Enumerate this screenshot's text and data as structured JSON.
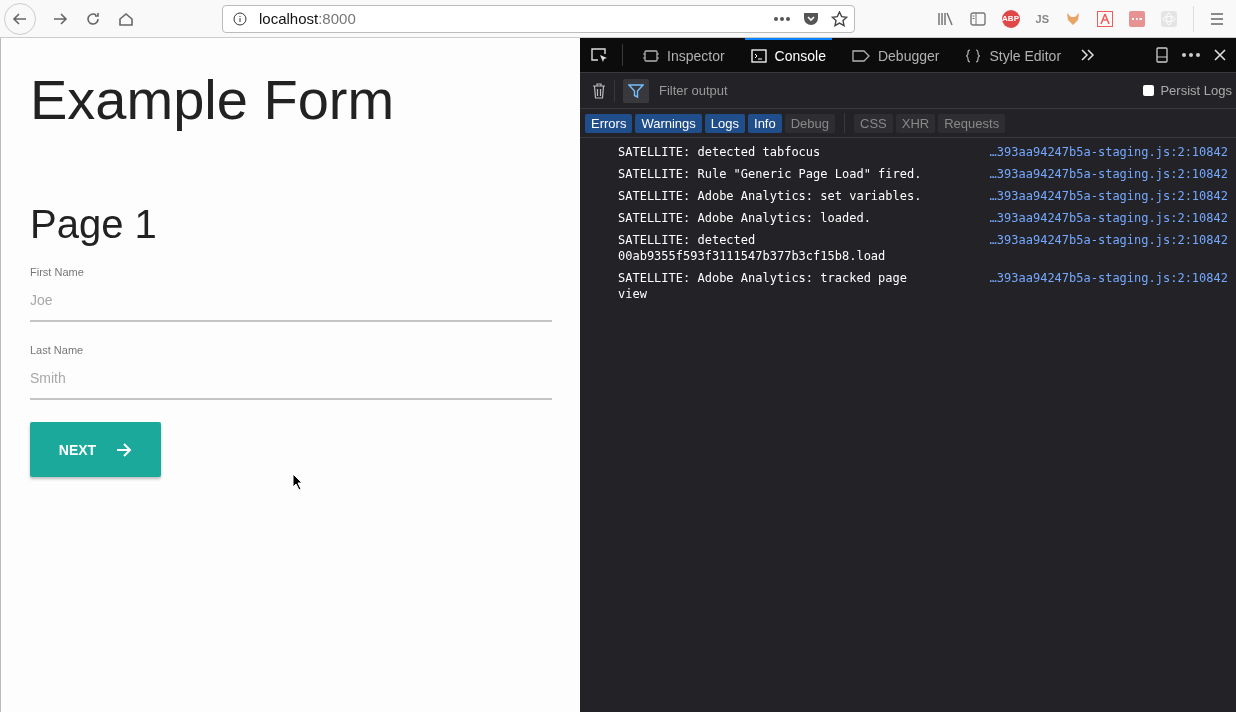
{
  "browser": {
    "url_host": "localhost",
    "url_port": ":8000",
    "extensions": [
      {
        "kind": "library"
      },
      {
        "kind": "sidebar"
      },
      {
        "kind": "abp",
        "label": "ABP"
      },
      {
        "kind": "js",
        "label": "JS"
      },
      {
        "kind": "fox"
      },
      {
        "kind": "adobe"
      },
      {
        "kind": "dots"
      },
      {
        "kind": "atom"
      }
    ]
  },
  "page": {
    "title": "Example Form",
    "subtitle": "Page 1",
    "fields": [
      {
        "label": "First Name",
        "placeholder": "Joe"
      },
      {
        "label": "Last Name",
        "placeholder": "Smith"
      }
    ],
    "button": "NEXT"
  },
  "devtools": {
    "tabs": [
      {
        "label": "Inspector",
        "kind": "inspector",
        "selected": false
      },
      {
        "label": "Console",
        "kind": "console",
        "selected": true
      },
      {
        "label": "Debugger",
        "kind": "debugger",
        "selected": false
      },
      {
        "label": "Style Editor",
        "kind": "style_editor",
        "selected": false
      }
    ],
    "filter_placeholder": "Filter output",
    "persist_logs": {
      "label": "Persist Logs",
      "checked": false
    },
    "filters": [
      {
        "label": "Errors",
        "selected": true
      },
      {
        "label": "Warnings",
        "selected": true
      },
      {
        "label": "Logs",
        "selected": true
      },
      {
        "label": "Info",
        "selected": true
      },
      {
        "label": "Debug",
        "selected": false
      }
    ],
    "net_filters": [
      {
        "label": "CSS",
        "selected": false
      },
      {
        "label": "XHR",
        "selected": false
      },
      {
        "label": "Requests",
        "selected": false
      }
    ],
    "logs": [
      {
        "message": "SATELLITE: detected tabfocus",
        "source": "…393aa94247b5a-staging.js:2:10842"
      },
      {
        "message": "SATELLITE: Rule \"Generic Page Load\" fired.",
        "source": "…393aa94247b5a-staging.js:2:10842"
      },
      {
        "message": "SATELLITE: Adobe Analytics: set variables.",
        "source": "…393aa94247b5a-staging.js:2:10842"
      },
      {
        "message": "SATELLITE: Adobe Analytics: loaded.",
        "source": "…393aa94247b5a-staging.js:2:10842"
      },
      {
        "message": "SATELLITE: detected 00ab9355f593f3111547b377b3cf15b8.load",
        "source": "…393aa94247b5a-staging.js:2:10842"
      },
      {
        "message": "SATELLITE: Adobe Analytics: tracked page view",
        "source": "…393aa94247b5a-staging.js:2:10842"
      }
    ]
  }
}
